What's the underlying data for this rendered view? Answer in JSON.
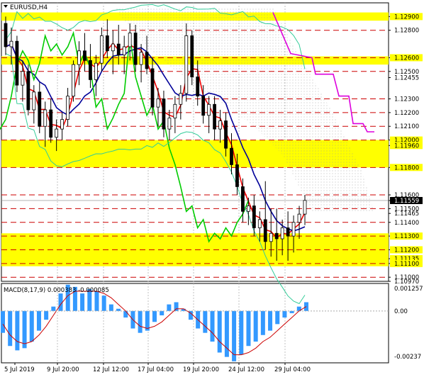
{
  "chart_data": [
    {
      "type": "candlestick",
      "title": "EURUSD,H4",
      "y_range": [
        1.1097,
        1.13
      ],
      "y_ticks": [
        "1.12900",
        "1.12800",
        "1.12600",
        "1.12500",
        "1.12455",
        "1.12300",
        "1.12200",
        "1.12100",
        "1.12000",
        "1.11960",
        "1.11800",
        "1.11600",
        "1.11559",
        "1.11500",
        "1.11465",
        "1.11400",
        "1.11300",
        "1.11200",
        "1.11135",
        "1.11100",
        "1.11000",
        "1.10970"
      ],
      "current_price": "1.11559",
      "grid": true,
      "yellow_zones": [
        [
          1.1287,
          1.1293
        ],
        [
          1.1255,
          1.1261
        ],
        [
          1.118,
          1.12
        ],
        [
          1.1108,
          1.1132
        ]
      ],
      "red_dashed_levels": [
        1.128,
        1.126,
        1.125,
        1.123,
        1.122,
        1.121,
        1.12,
        1.118,
        1.116,
        1.115,
        1.114,
        1.113,
        1.112,
        1.111,
        1.11
      ],
      "x_labels": [
        "5 Jul 2019",
        "9 Jul 20:00",
        "12 Jul 12:00",
        "17 Jul 04:00",
        "19 Jul 20:00",
        "24 Jul 12:00",
        "29 Jul 04:00"
      ],
      "candles": [
        [
          1.1285,
          1.129,
          1.1262,
          1.1268
        ],
        [
          1.1268,
          1.1282,
          1.1255,
          1.1272
        ],
        [
          1.1272,
          1.1276,
          1.1235,
          1.124
        ],
        [
          1.124,
          1.1258,
          1.1228,
          1.125
        ],
        [
          1.125,
          1.1255,
          1.1218,
          1.1222
        ],
        [
          1.1222,
          1.124,
          1.1212,
          1.1235
        ],
        [
          1.1235,
          1.1242,
          1.1205,
          1.121
        ],
        [
          1.121,
          1.1228,
          1.1195,
          1.1222
        ],
        [
          1.1222,
          1.123,
          1.1198,
          1.1202
        ],
        [
          1.1202,
          1.1215,
          1.1192,
          1.1208
        ],
        [
          1.1208,
          1.122,
          1.12,
          1.1215
        ],
        [
          1.1215,
          1.1238,
          1.121,
          1.1232
        ],
        [
          1.1232,
          1.1258,
          1.1228,
          1.1255
        ],
        [
          1.1255,
          1.1272,
          1.124,
          1.1265
        ],
        [
          1.1265,
          1.1278,
          1.125,
          1.1258
        ],
        [
          1.1258,
          1.127,
          1.1238,
          1.1244
        ],
        [
          1.1244,
          1.1262,
          1.1232,
          1.1256
        ],
        [
          1.1256,
          1.1282,
          1.125,
          1.1276
        ],
        [
          1.1276,
          1.1288,
          1.126,
          1.1265
        ],
        [
          1.1265,
          1.128,
          1.1248,
          1.127
        ],
        [
          1.127,
          1.1284,
          1.1255,
          1.1262
        ],
        [
          1.1262,
          1.1276,
          1.1248,
          1.1268
        ],
        [
          1.1268,
          1.1285,
          1.1258,
          1.1278
        ],
        [
          1.1278,
          1.1284,
          1.125,
          1.1255
        ],
        [
          1.1255,
          1.127,
          1.1242,
          1.1264
        ],
        [
          1.1264,
          1.1276,
          1.1248,
          1.1252
        ],
        [
          1.1252,
          1.126,
          1.1218,
          1.1224
        ],
        [
          1.1224,
          1.1238,
          1.121,
          1.123
        ],
        [
          1.123,
          1.1236,
          1.1202,
          1.1208
        ],
        [
          1.1208,
          1.1222,
          1.12,
          1.1216
        ],
        [
          1.1216,
          1.1232,
          1.1205,
          1.1226
        ],
        [
          1.1226,
          1.124,
          1.1215,
          1.1234
        ],
        [
          1.1234,
          1.1285,
          1.1228,
          1.1276
        ],
        [
          1.1276,
          1.128,
          1.124,
          1.1246
        ],
        [
          1.1246,
          1.1258,
          1.1225,
          1.1232
        ],
        [
          1.1232,
          1.124,
          1.1212,
          1.1218
        ],
        [
          1.1218,
          1.1232,
          1.1205,
          1.1226
        ],
        [
          1.1226,
          1.1232,
          1.12,
          1.1208
        ],
        [
          1.1208,
          1.1222,
          1.1198,
          1.1214
        ],
        [
          1.1214,
          1.122,
          1.1188,
          1.1194
        ],
        [
          1.1194,
          1.1205,
          1.1175,
          1.1182
        ],
        [
          1.1182,
          1.119,
          1.116,
          1.1166
        ],
        [
          1.1166,
          1.1172,
          1.114,
          1.1148
        ],
        [
          1.1148,
          1.1158,
          1.1138,
          1.1152
        ],
        [
          1.1152,
          1.116,
          1.113,
          1.1136
        ],
        [
          1.1136,
          1.1148,
          1.1126,
          1.1142
        ],
        [
          1.1142,
          1.117,
          1.112,
          1.1126
        ],
        [
          1.1126,
          1.115,
          1.1115,
          1.1132
        ],
        [
          1.1132,
          1.115,
          1.1112,
          1.1128
        ],
        [
          1.1128,
          1.1142,
          1.1116,
          1.1136
        ],
        [
          1.1136,
          1.1148,
          1.1112,
          1.113
        ],
        [
          1.113,
          1.1145,
          1.1118,
          1.114
        ],
        [
          1.114,
          1.1152,
          1.1128,
          1.1146
        ],
        [
          1.1146,
          1.116,
          1.1138,
          1.1156
        ]
      ],
      "macd": {
        "label": "MACD(8,17,9) 0.000383 -0.000085",
        "y_ticks": [
          "0.001257",
          "0.00",
          "-0.00237"
        ],
        "y_range": [
          -0.00237,
          0.001257
        ],
        "histogram": [
          -0.001,
          -0.0016,
          -0.0018,
          -0.0017,
          -0.0014,
          -0.0009,
          -0.0004,
          0.0002,
          0.0008,
          0.0012,
          0.0011,
          0.0008,
          0.001,
          0.0009,
          0.0007,
          0.0003,
          0.0001,
          -0.0003,
          -0.0008,
          -0.001,
          -0.0009,
          -0.0005,
          -0.0002,
          0.0003,
          0.0004,
          0.0001,
          -0.0004,
          -0.0008,
          -0.001,
          -0.0014,
          -0.0019,
          -0.0021,
          -0.0023,
          -0.002,
          -0.0016,
          -0.0014,
          -0.0011,
          -0.0009,
          -0.0006,
          -0.0003,
          -0.0001,
          0.0002,
          0.0004
        ],
        "signal": [
          -0.0006,
          -0.0011,
          -0.0014,
          -0.0015,
          -0.0014,
          -0.0011,
          -0.0007,
          -0.0002,
          0.0003,
          0.0007,
          0.0009,
          0.0009,
          0.0009,
          0.0009,
          0.0008,
          0.0006,
          0.0003,
          0.0,
          -0.0004,
          -0.0007,
          -0.0008,
          -0.0007,
          -0.0005,
          -0.0002,
          0.0001,
          0.0001,
          -0.0001,
          -0.0004,
          -0.0007,
          -0.001,
          -0.0014,
          -0.0017,
          -0.002,
          -0.002,
          -0.0019,
          -0.0017,
          -0.0014,
          -0.0012,
          -0.0009,
          -0.0006,
          -0.0003,
          0.0,
          0.0002
        ]
      }
    }
  ],
  "colors": {
    "bull": "#000000",
    "bear": "#000000",
    "bull_fill": "#ffffff",
    "yellow_zone": "#ffff00",
    "red_level": "#cc0000",
    "ma_red": "#ee0000",
    "ma_blue": "#000099",
    "ma_green": "#00cc00",
    "ma_magenta": "#dd00dd",
    "bollinger": "#33cc99",
    "macd_hist": "#3399ff",
    "macd_signal": "#cc0000",
    "grid": "#c0c0c0"
  },
  "icons": [
    "chart-menu-icon"
  ]
}
